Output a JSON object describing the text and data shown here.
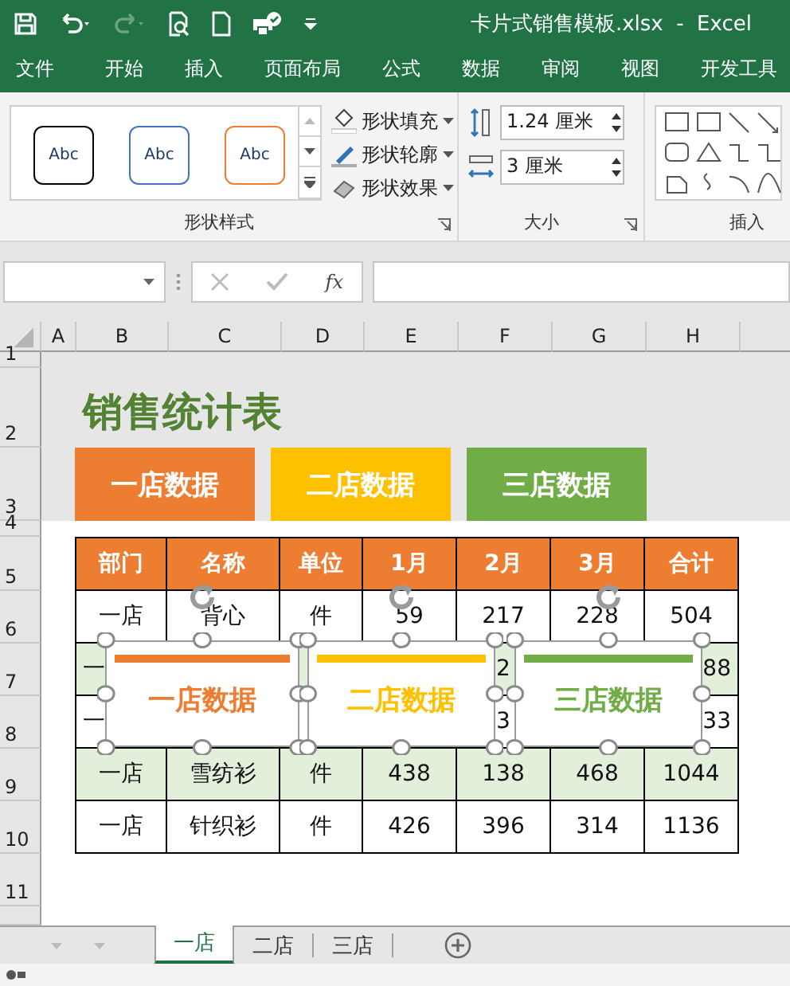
{
  "window": {
    "title": "卡片式销售模板.xlsx  -  Excel"
  },
  "menu_tabs": [
    "文件",
    "开始",
    "插入",
    "页面布局",
    "公式",
    "数据",
    "审阅",
    "视图",
    "开发工具"
  ],
  "ribbon": {
    "style_gallery": [
      {
        "label": "Abc",
        "color": "#000000"
      },
      {
        "label": "Abc",
        "color": "#4472c4"
      },
      {
        "label": "Abc",
        "color": "#ed7d31"
      }
    ],
    "shape_commands": [
      "形状填充",
      "形状轮廓",
      "形状效果"
    ],
    "style_group": "形状样式",
    "height_field": "1.24 厘米",
    "width_field": "3 厘米",
    "size_group": "大小",
    "insert_group": "插入"
  },
  "formula_bar": {
    "function_label": "fx"
  },
  "sheet": {
    "columns": [
      "A",
      "B",
      "C",
      "D",
      "E",
      "F",
      "G",
      "H"
    ],
    "row_numbers": [
      "1",
      "2",
      "3",
      "4",
      "5",
      "6",
      "7",
      "8",
      "9",
      "10",
      "11"
    ],
    "title": "销售统计表",
    "store_buttons": [
      {
        "label": "一店数据",
        "color": "#ed7d31"
      },
      {
        "label": "二店数据",
        "color": "#ffc000"
      },
      {
        "label": "三店数据",
        "color": "#70ad47"
      }
    ],
    "table": {
      "columns": [
        "部门",
        "名称",
        "单位",
        "1月",
        "2月",
        "3月",
        "合计"
      ],
      "rows": [
        {
          "shaded": false,
          "b": "一店",
          "c": "背心",
          "d": "件",
          "e": "59",
          "f": "217",
          "g": "228",
          "h": "504"
        },
        {
          "shaded": true,
          "b": "一",
          "f": "2",
          "h": "88"
        },
        {
          "shaded": false,
          "b": "一",
          "f": "3",
          "h": "33"
        },
        {
          "shaded": true,
          "b": "一店",
          "c": "雪纺衫",
          "d": "件",
          "e": "438",
          "f": "138",
          "g": "468",
          "h": "1044"
        },
        {
          "shaded": false,
          "b": "一店",
          "c": "针织衫",
          "d": "件",
          "e": "426",
          "f": "396",
          "g": "314",
          "h": "1136"
        }
      ]
    },
    "cards": [
      {
        "label": "一店数据",
        "color": "#ed7d31"
      },
      {
        "label": "二店数据",
        "color": "#ffc000"
      },
      {
        "label": "三店数据",
        "color": "#70ad47"
      }
    ]
  },
  "sheet_tabs": [
    {
      "label": "一店",
      "selected": true
    },
    {
      "label": "二店",
      "selected": false
    },
    {
      "label": "三店",
      "selected": false
    }
  ]
}
